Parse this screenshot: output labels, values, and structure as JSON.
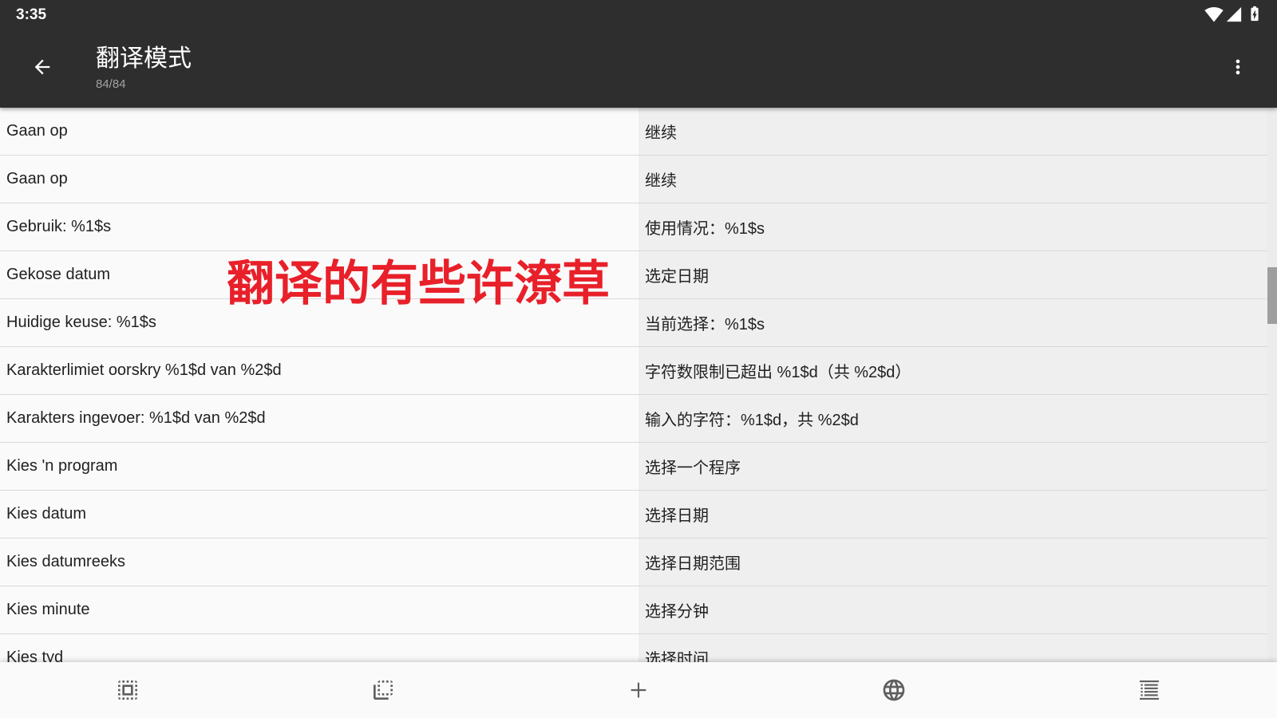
{
  "status_bar": {
    "time": "3:35",
    "icons": [
      "wifi-icon",
      "signal-icon",
      "battery-charging-icon"
    ]
  },
  "app_bar": {
    "navigation_icon": "back-arrow-icon",
    "title": "翻译模式",
    "subtitle": "84/84",
    "overflow_icon": "more-vert-icon"
  },
  "rows": [
    {
      "source": "Gaan op",
      "translation": "继续"
    },
    {
      "source": "Gaan op",
      "translation": "继续"
    },
    {
      "source": "Gebruik: %1$s",
      "translation": "使用情况：%1$s"
    },
    {
      "source": "Gekose datum",
      "translation": "选定日期"
    },
    {
      "source": "Huidige keuse: %1$s",
      "translation": "当前选择：%1$s"
    },
    {
      "source": "Karakterlimiet oorskry %1$d van %2$d",
      "translation": "字符数限制已超出 %1$d（共 %2$d）"
    },
    {
      "source": "Karakters ingevoer: %1$d van %2$d",
      "translation": "输入的字符：%1$d，共 %2$d"
    },
    {
      "source": "Kies 'n program",
      "translation": "选择一个程序"
    },
    {
      "source": "Kies datum",
      "translation": "选择日期"
    },
    {
      "source": "Kies datumreeks",
      "translation": "选择日期范围"
    },
    {
      "source": "Kies minute",
      "translation": "选择分钟"
    },
    {
      "source": "Kies tyd",
      "translation": "选择时间"
    }
  ],
  "annotation": {
    "text": "翻译的有些许潦草"
  },
  "bottom_bar": {
    "actions": [
      {
        "icon": "select-all-icon"
      },
      {
        "icon": "flip-to-back-icon"
      },
      {
        "icon": "add-icon"
      },
      {
        "icon": "globe-icon"
      },
      {
        "icon": "list-icon"
      }
    ]
  },
  "colors": {
    "app_bar": "#2e2e2e",
    "annotation_text": "#e8202a",
    "source_column": "#fafafa",
    "translation_column": "#efefef",
    "bottom_icons": "#5f5f5f"
  }
}
